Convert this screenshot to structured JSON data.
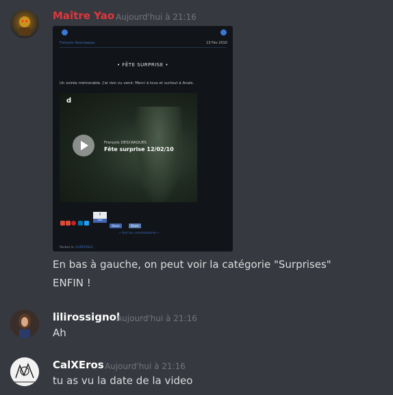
{
  "messages": [
    {
      "author": "Maître Yao",
      "author_color": "#e0363d",
      "timestamp": "Aujourd'hui à 21:16",
      "embed": {
        "byline": "François Descraques",
        "date": "13 Fév 2010",
        "title": "•   FÊTE SURPRISE   •",
        "body": "Un soirée mémorable. J'ai rien vu venir. Merci à tous et surtout à Anaïs.",
        "video": {
          "logo": "d",
          "author": "François DESCRAQUES",
          "title": "Fête surprise 12/02/10"
        },
        "like_count": "0",
        "like_label": "Like",
        "share_label": "Share",
        "share2_label": "Share",
        "comments_link": "• Voir les commentaires •",
        "posted_in_label": "Posted in",
        "category": "SURPRISES"
      },
      "lines": [
        "En bas à gauche, on peut voir la catégorie \"Surprises\"",
        "ENFIN !"
      ]
    },
    {
      "author": "lilirossignol",
      "author_color": "#ffffff",
      "timestamp": "Aujourd'hui à 21:16",
      "lines": [
        "Ah"
      ]
    },
    {
      "author": "CalXEros",
      "author_color": "#ffffff",
      "timestamp": "Aujourd'hui à 21:16",
      "lines": [
        "tu as vu la date de la  video"
      ]
    }
  ],
  "icons": {
    "avatar1": "warrior-avatar-icon",
    "avatar2": "woman-avatar-icon",
    "avatar3": "sketch-avatar-icon",
    "play": "play-icon"
  },
  "colors": {
    "background": "#36393f",
    "timestamp": "#72767d",
    "link": "#3a6fc0"
  }
}
